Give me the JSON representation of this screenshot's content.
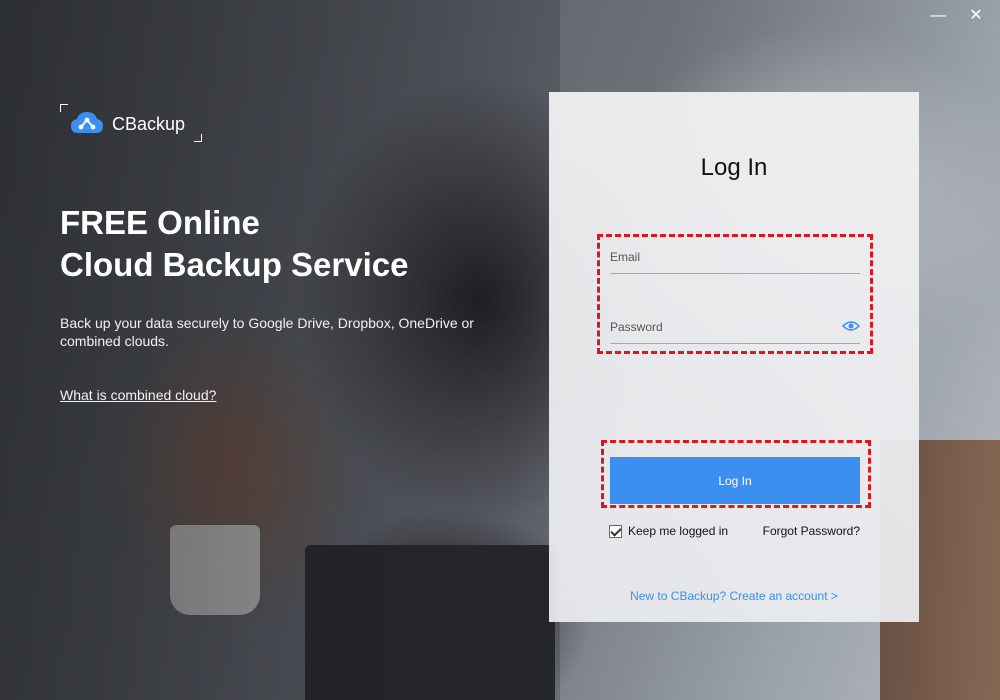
{
  "window": {
    "minimize_label": "—",
    "close_label": "✕"
  },
  "brand": {
    "name": "CBackup",
    "logo_icon": "cloud-network-icon",
    "accent": "#3a8ff0"
  },
  "hero": {
    "headline_line1": "FREE Online",
    "headline_line2": "Cloud Backup Service",
    "subtext": "Back up your data securely to Google Drive, Dropbox, OneDrive or combined clouds.",
    "link": "What is combined cloud?"
  },
  "login": {
    "title": "Log In",
    "email_placeholder": "Email",
    "email_value": "",
    "password_placeholder": "Password",
    "password_value": "",
    "show_password_icon": "eye-icon",
    "button_label": "Log In",
    "keep_logged_in_label": "Keep me logged in",
    "keep_logged_in_checked": true,
    "forgot_label": "Forgot Password?",
    "create_account_label": "New to CBackup? Create an account >"
  },
  "colors": {
    "button_bg": "#3a8ff0",
    "highlight": "#e0141a",
    "link": "#3a8ff0"
  }
}
